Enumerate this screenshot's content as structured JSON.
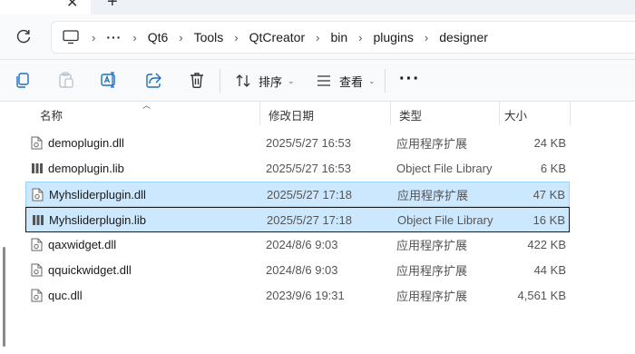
{
  "tabbar": {
    "close_glyph": "✕",
    "new_glyph": "+"
  },
  "address": {
    "overflow": "···",
    "crumbs": [
      "Qt6",
      "Tools",
      "QtCreator",
      "bin",
      "plugins",
      "designer"
    ]
  },
  "toolbar": {
    "sort_label": "排序",
    "view_label": "查看",
    "more_label": "···"
  },
  "columns": {
    "name": "名称",
    "date": "修改日期",
    "type": "类型",
    "size": "大小"
  },
  "files": [
    {
      "icon": "dll-file-icon",
      "name": "demoplugin.dll",
      "date": "2025/5/27 16:53",
      "type": "应用程序扩展",
      "size": "24 KB"
    },
    {
      "icon": "lib-file-icon",
      "name": "demoplugin.lib",
      "date": "2025/5/27 16:53",
      "type": "Object File Library",
      "size": "6 KB"
    },
    {
      "icon": "dll-file-icon",
      "name": "Myhsliderplugin.dll",
      "date": "2025/5/27 17:18",
      "type": "应用程序扩展",
      "size": "47 KB",
      "selected": true
    },
    {
      "icon": "lib-file-icon",
      "name": "Myhsliderplugin.lib",
      "date": "2025/5/27 17:18",
      "type": "Object File Library",
      "size": "16 KB",
      "selected": true,
      "focused": true
    },
    {
      "icon": "dll-file-icon",
      "name": "qaxwidget.dll",
      "date": "2024/8/6 9:03",
      "type": "应用程序扩展",
      "size": "422 KB"
    },
    {
      "icon": "dll-file-icon",
      "name": "qquickwidget.dll",
      "date": "2024/8/6 9:03",
      "type": "应用程序扩展",
      "size": "44 KB"
    },
    {
      "icon": "dll-file-icon",
      "name": "quc.dll",
      "date": "2023/9/6 19:31",
      "type": "应用程序扩展",
      "size": "4,561 KB"
    }
  ]
}
